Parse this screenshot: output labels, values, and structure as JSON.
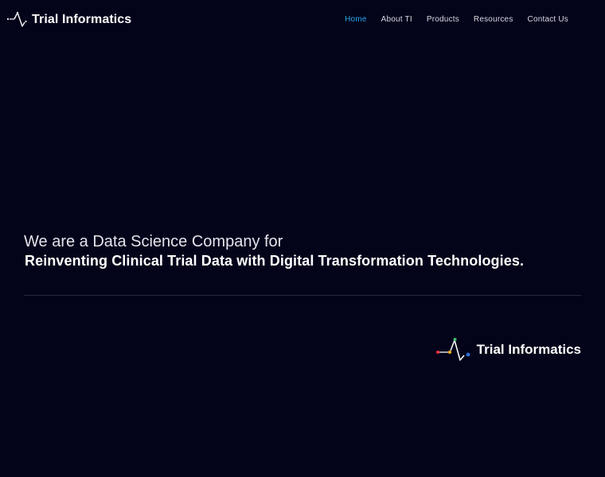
{
  "header": {
    "logo_text": "Trial Informatics",
    "logo_icon": "pulse-signal-icon"
  },
  "nav": {
    "items": [
      {
        "label": "Home",
        "active": true
      },
      {
        "label": "About TI",
        "active": false
      },
      {
        "label": "Products",
        "active": false
      },
      {
        "label": "Resources",
        "active": false
      },
      {
        "label": "Contact Us",
        "active": false
      }
    ]
  },
  "hero": {
    "line1": "We are a Data Science Company for",
    "line2": "Reinventing Clinical Trial Data with Digital Transformation Technologies."
  },
  "footer_logo": {
    "text": "Trial Informatics",
    "icon": "pulse-signal-colored-icon"
  },
  "colors": {
    "background": "#03031a",
    "nav_active": "#24a6e8",
    "divider": "#252843",
    "dot_red": "#e8303a",
    "dot_yellow": "#f2b322",
    "dot_green": "#3bbf6a",
    "dot_blue": "#2f6fd8"
  }
}
